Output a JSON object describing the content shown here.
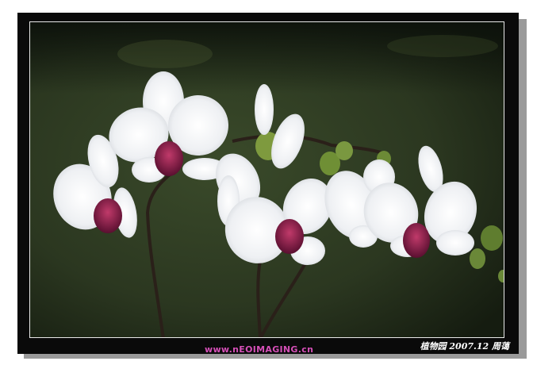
{
  "photo": {
    "subject": "white-phalaenopsis-orchids",
    "background_color": "#2f3b22",
    "petal_color": "#f3f4f6",
    "lip_color": "#7d1c4a"
  },
  "watermark": {
    "text": "www.nEOIMAGING.cn"
  },
  "caption": {
    "text": "植物园 2007.12 周蔼"
  }
}
